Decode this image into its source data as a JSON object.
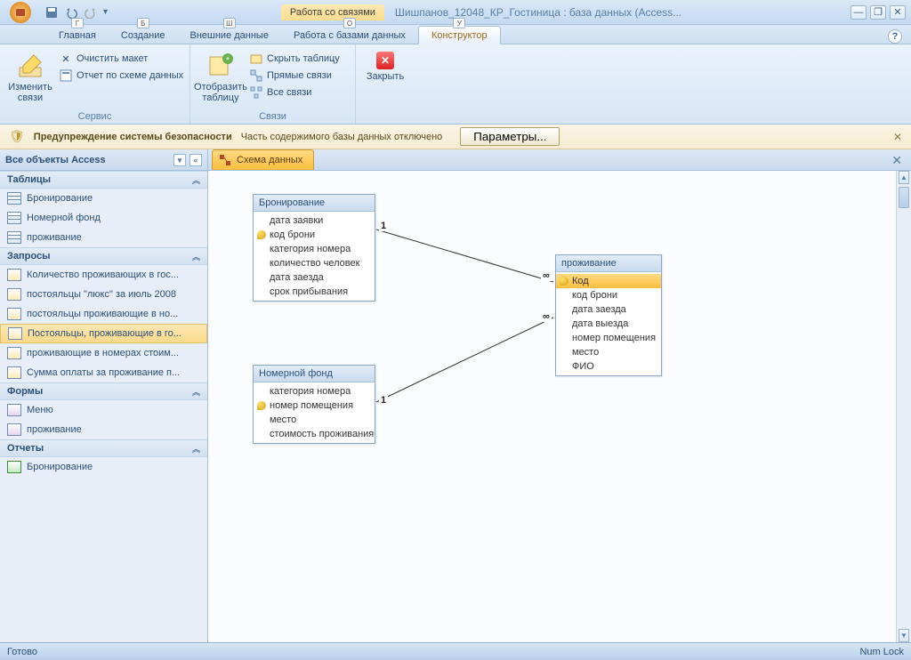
{
  "titlebar": {
    "context_label": "Работа со связями",
    "doc_title": "Шишпанов_12048_КР_Гостиница : база данных (Access..."
  },
  "ribbon_tabs": {
    "home": "Главная",
    "create": "Создание",
    "external": "Внешние данные",
    "dbtools": "Работа с базами данных",
    "designer": "Конструктор",
    "sc_home": "Г",
    "sc_create": "Б",
    "sc_external": "Ш",
    "sc_dbtools": "О",
    "sc_designer": "У"
  },
  "ribbon": {
    "edit_rel": "Изменить связи",
    "clear_layout": "Очистить макет",
    "schema_report": "Отчет по схеме данных",
    "group_service": "Сервис",
    "show_table": "Отобразить таблицу",
    "hide_table": "Скрыть таблицу",
    "direct_rel": "Прямые связи",
    "all_rel": "Все связи",
    "group_links": "Связи",
    "close": "Закрыть"
  },
  "security": {
    "title": "Предупреждение системы безопасности",
    "msg": "Часть содержимого базы данных отключено",
    "btn": "Параметры..."
  },
  "nav": {
    "header": "Все объекты Access",
    "g_tables": "Таблицы",
    "t1": "Бронирование",
    "t2": "Номерной фонд",
    "t3": "проживание",
    "g_queries": "Запросы",
    "q1": "Количество проживающих в гос...",
    "q2": "постояльцы \"люкс\" за июль 2008",
    "q3": "постояльцы проживающие в но...",
    "q4": "Постояльцы, проживающие в го...",
    "q5": "проживающие в номерах стоим...",
    "q6": "Сумма оплаты за проживание п...",
    "g_forms": "Формы",
    "f1": "Меню",
    "f2": "проживание",
    "g_reports": "Отчеты",
    "r1": "Бронирование"
  },
  "doc_tab": "Схема данных",
  "tables": {
    "booking": {
      "title": "Бронирование",
      "f1": "дата заявки",
      "f2": "код брони",
      "f3": "категория номера",
      "f4": "количество человек",
      "f5": "дата заезда",
      "f6": "срок прибывания"
    },
    "roomfund": {
      "title": "Номерной фонд",
      "f1": "категория номера",
      "f2": "номер помещения",
      "f3": "место",
      "f4": "стоимость проживания"
    },
    "living": {
      "title": "проживание",
      "f1": "Код",
      "f2": "код брони",
      "f3": "дата заезда",
      "f4": "дата выезда",
      "f5": "номер помещения",
      "f6": "место",
      "f7": "ФИО"
    }
  },
  "rel": {
    "one": "1",
    "many": "∞"
  },
  "status": {
    "ready": "Готово",
    "numlock": "Num Lock"
  }
}
